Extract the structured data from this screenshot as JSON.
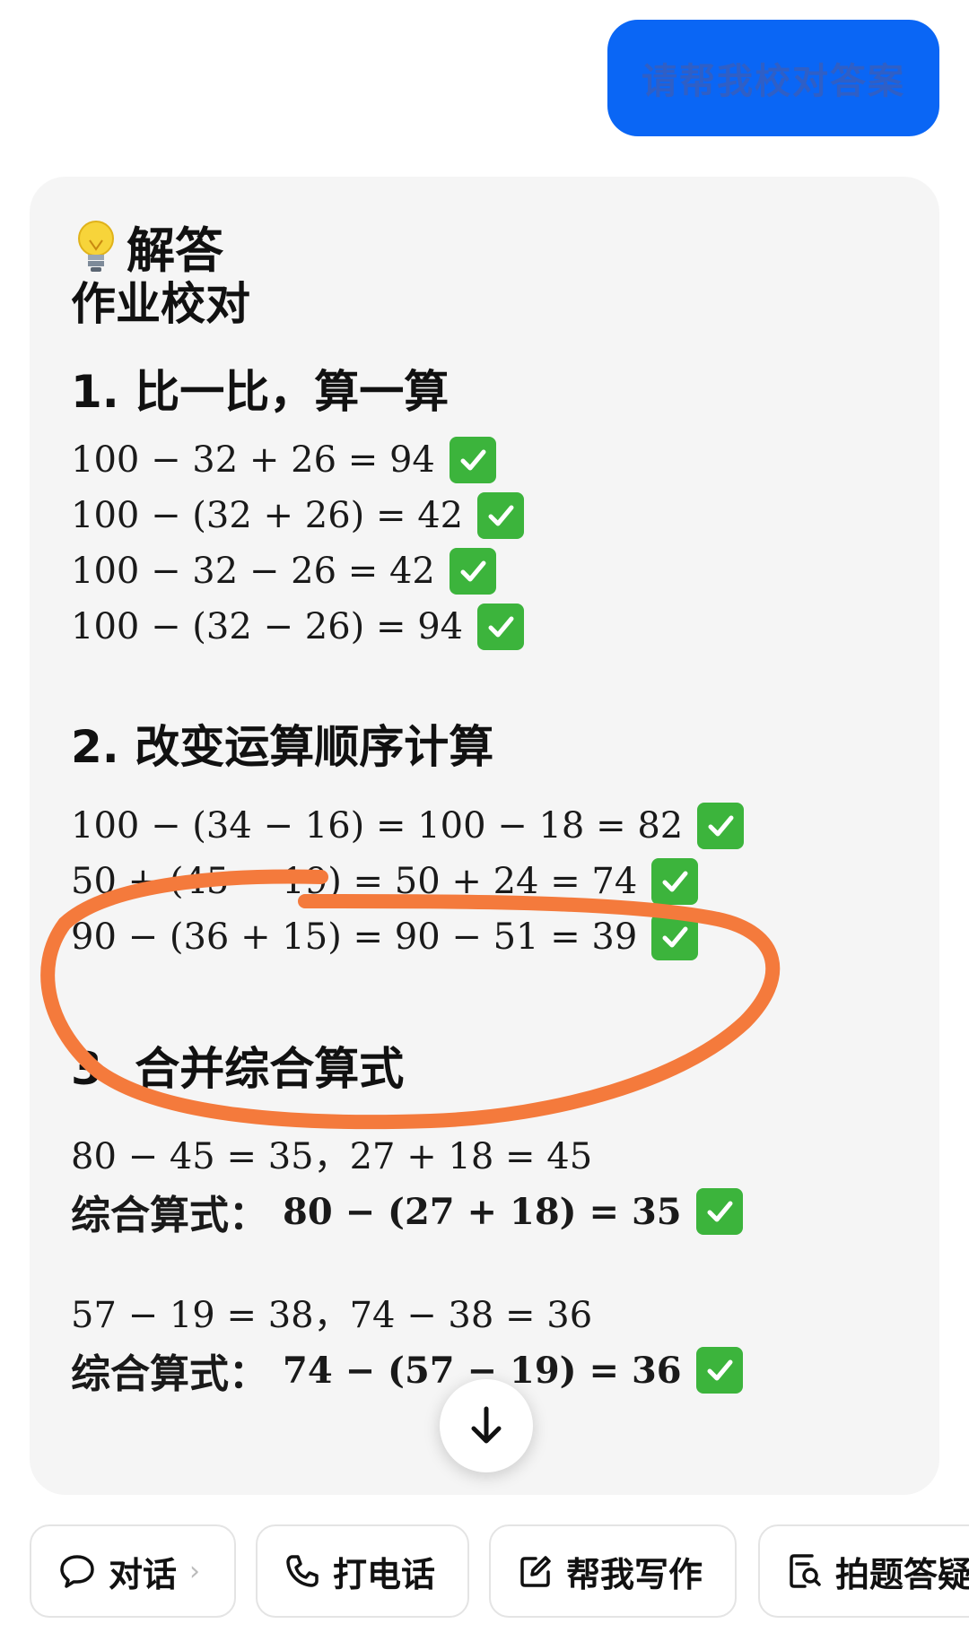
{
  "user_message": {
    "text": "请帮我校对答案"
  },
  "answer": {
    "header_label": "解答",
    "title": "作业校对",
    "sections": [
      {
        "heading": "1. 比一比，算一算",
        "equations": [
          "100 − 32 + 26 = 94",
          "100 − (32 + 26) = 42",
          "100 − 32 − 26 = 42",
          "100 − (32 − 26) = 94"
        ]
      },
      {
        "heading": "2. 改变运算顺序计算",
        "equations": [
          "100 − (34 − 16) = 100 − 18 = 82",
          "50 + (45 − 19) = 50 + 24 = 74",
          "90 − (36 + 15) = 90 − 51 = 39"
        ]
      },
      {
        "heading": "3. 合并综合算式",
        "items": [
          {
            "step": "80 − 45 = 35，27 + 18 = 45",
            "combined_label": "综合算式：",
            "combined": "80 − (27 + 18) = 35"
          },
          {
            "step": "57 − 19 = 38，74 − 38 = 36",
            "combined_label": "综合算式：",
            "combined": "74 − (57 − 19) = 36"
          }
        ]
      }
    ]
  },
  "bottom_bar": {
    "chips": [
      {
        "label": "对话",
        "icon": "chat-bubble-icon"
      },
      {
        "label": "打电话",
        "icon": "phone-icon"
      },
      {
        "label": "帮我写作",
        "icon": "edit-icon"
      },
      {
        "label": "拍题答疑",
        "icon": "photo-search-icon"
      }
    ]
  },
  "colors": {
    "user_bubble": "#0a66f5",
    "card_bg": "#f5f5f5",
    "check": "#3cb43c",
    "annotation": "#f47a3c"
  }
}
